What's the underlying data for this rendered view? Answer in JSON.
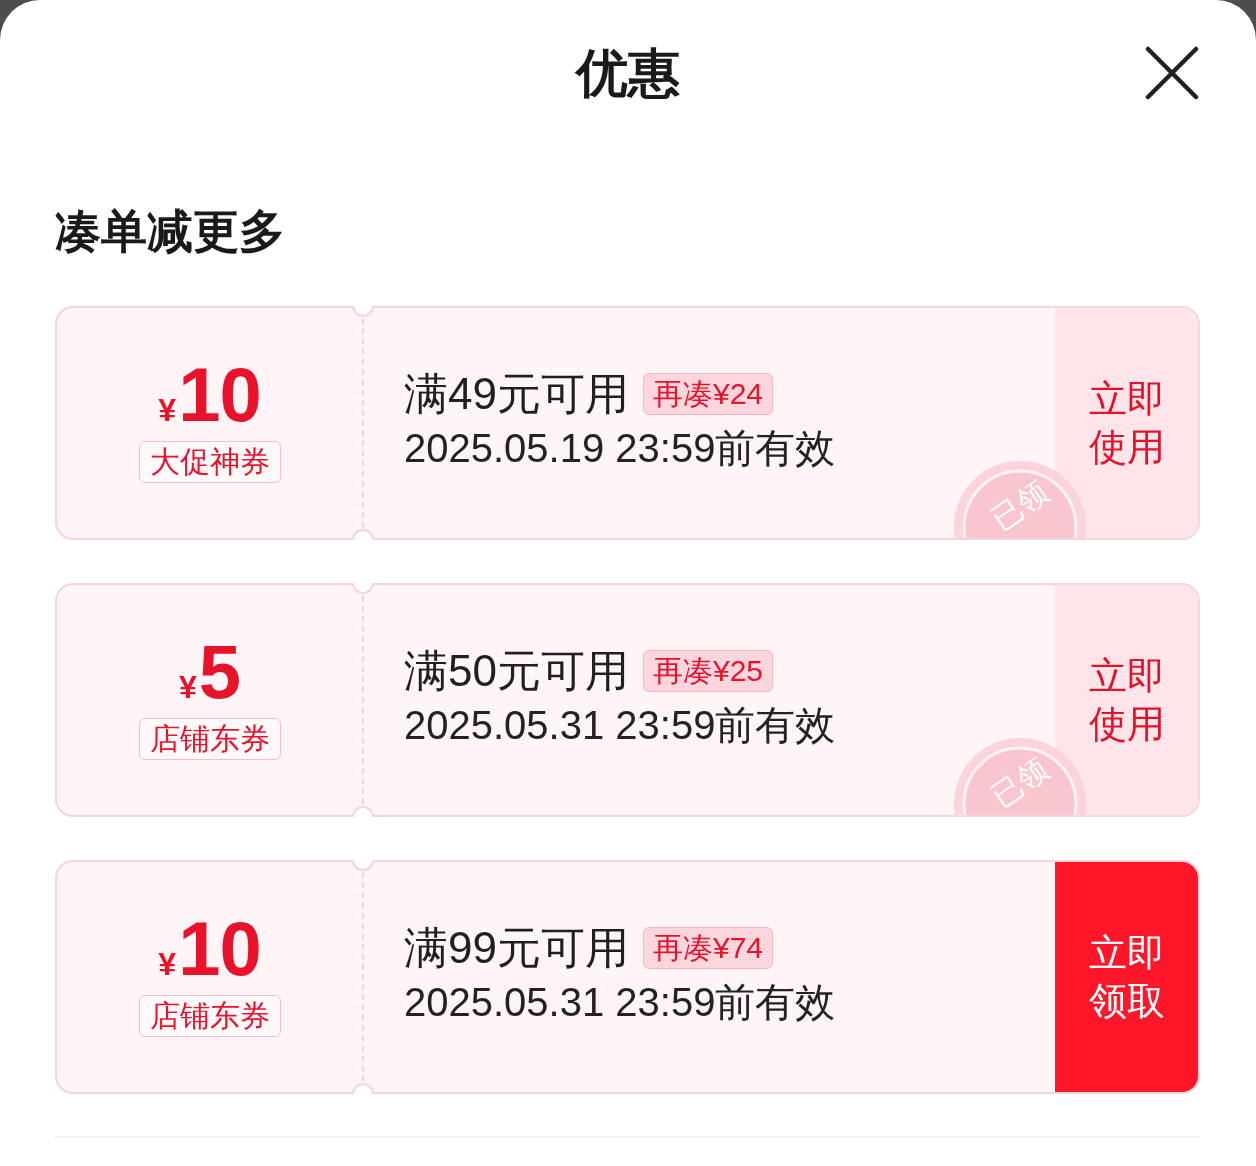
{
  "header": {
    "title": "优惠"
  },
  "section": {
    "title": "凑单减更多"
  },
  "coupons": [
    {
      "currency": "¥",
      "amount": "10",
      "label": "大促神券",
      "condition": "满49元可用",
      "shortfall": "再凑¥24",
      "validity": "2025.05.19 23:59前有效",
      "action": "立即使用",
      "claimed": true,
      "stamp": "已领"
    },
    {
      "currency": "¥",
      "amount": "5",
      "label": "店铺东券",
      "condition": "满50元可用",
      "shortfall": "再凑¥25",
      "validity": "2025.05.31 23:59前有效",
      "action": "立即使用",
      "claimed": true,
      "stamp": "已领"
    },
    {
      "currency": "¥",
      "amount": "10",
      "label": "店铺东券",
      "condition": "满99元可用",
      "shortfall": "再凑¥74",
      "validity": "2025.05.31 23:59前有效",
      "action": "立即领取",
      "claimed": false
    }
  ]
}
